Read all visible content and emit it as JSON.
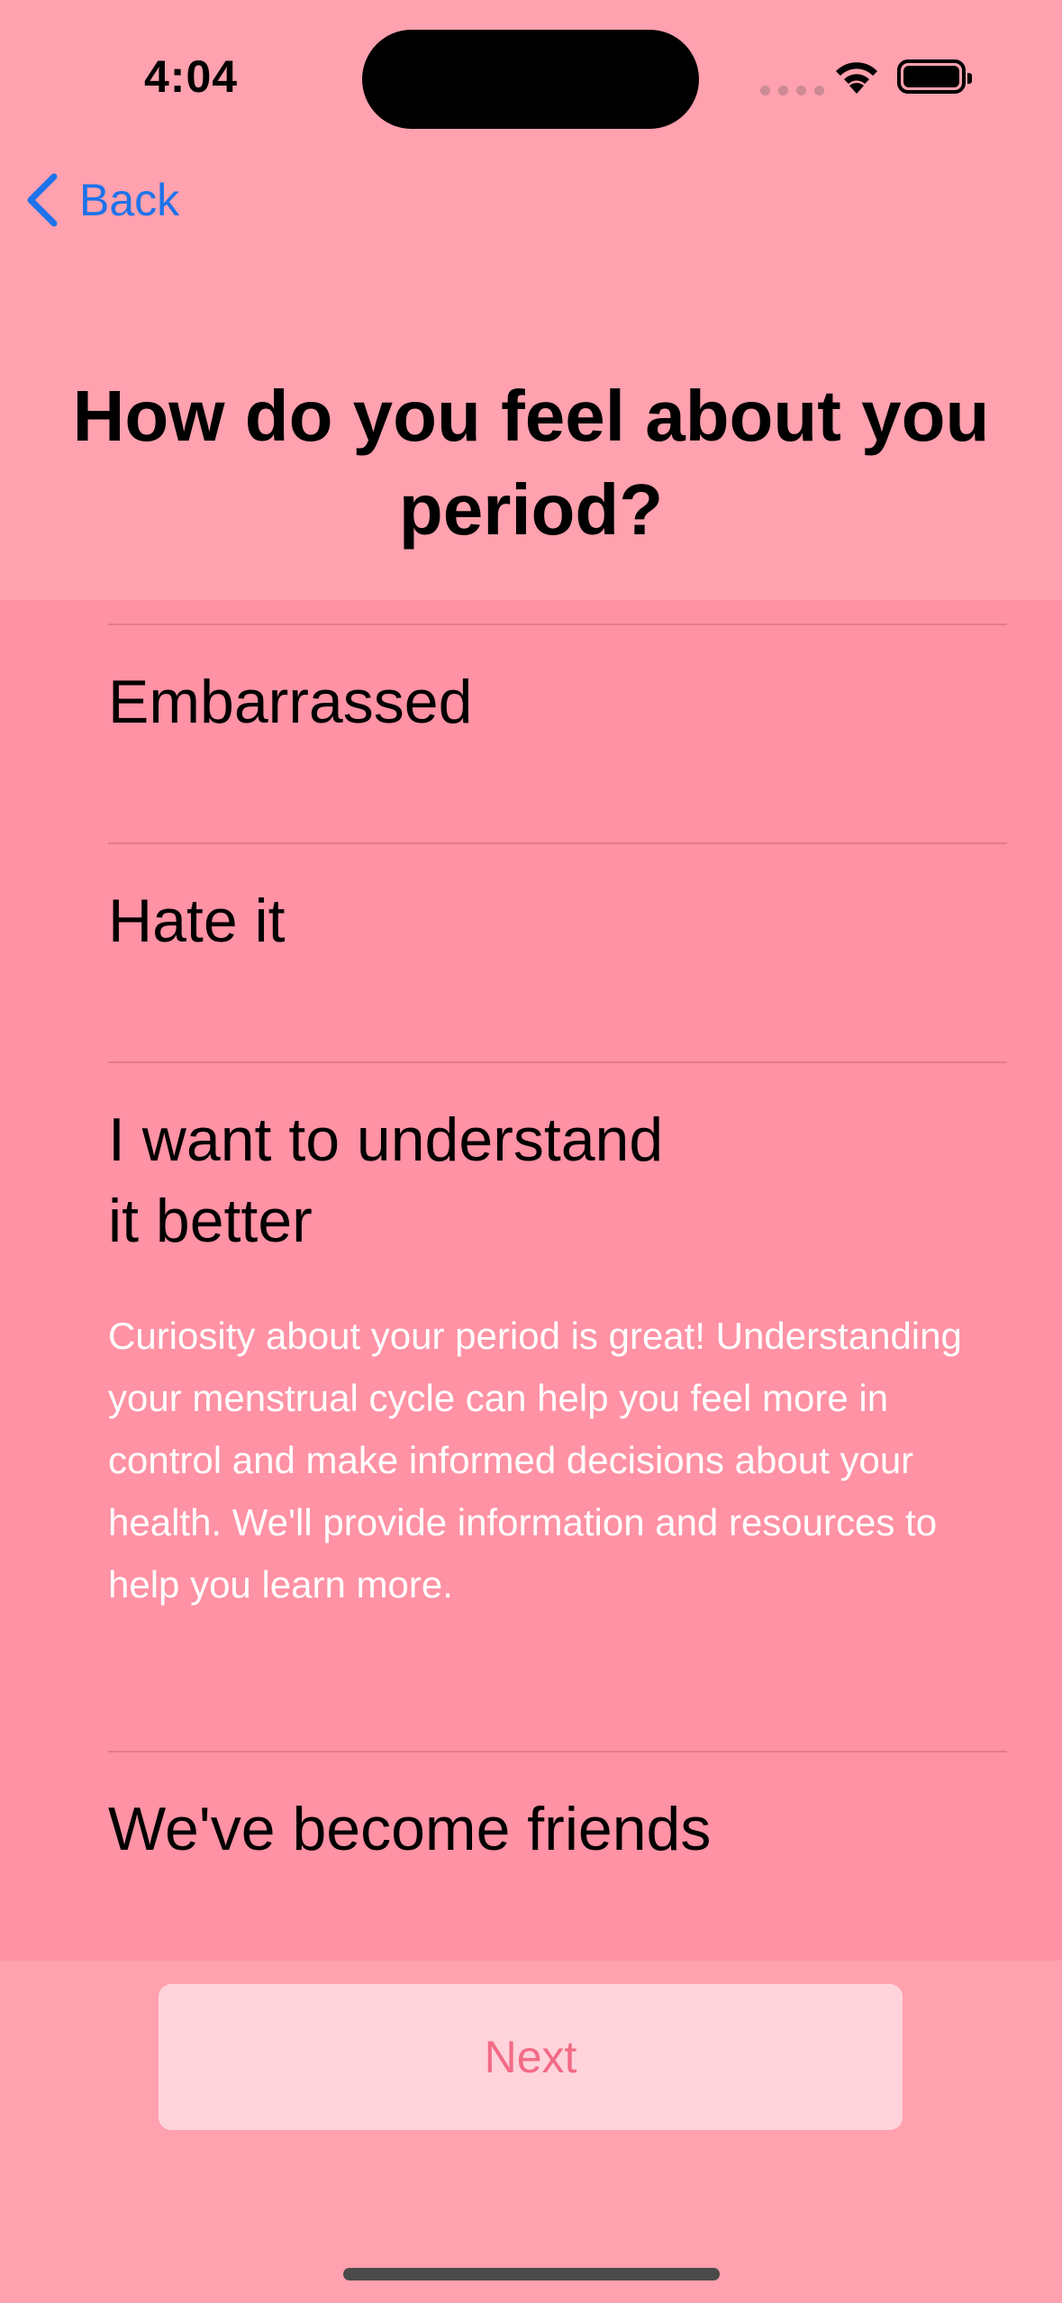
{
  "status_bar": {
    "time": "4:04"
  },
  "nav": {
    "back_label": "Back",
    "back_color": "#1d73ea"
  },
  "title": "How do you feel about you period?",
  "options": [
    {
      "label": "Embarrassed"
    },
    {
      "label": "Hate it"
    },
    {
      "label": "I want to understand\nit better",
      "description": "Curiosity about your period is great! Understanding your menstrual cycle can help you feel more in control and make informed decisions about your health. We'll provide information and resources to help you learn more."
    },
    {
      "label": "We've become friends"
    }
  ],
  "next_button": {
    "label": "Next"
  },
  "colors": {
    "background": "#ffa1ae",
    "list_background": "#ff92a4",
    "button_background": "#ffd3db",
    "button_text": "#f26b86"
  }
}
